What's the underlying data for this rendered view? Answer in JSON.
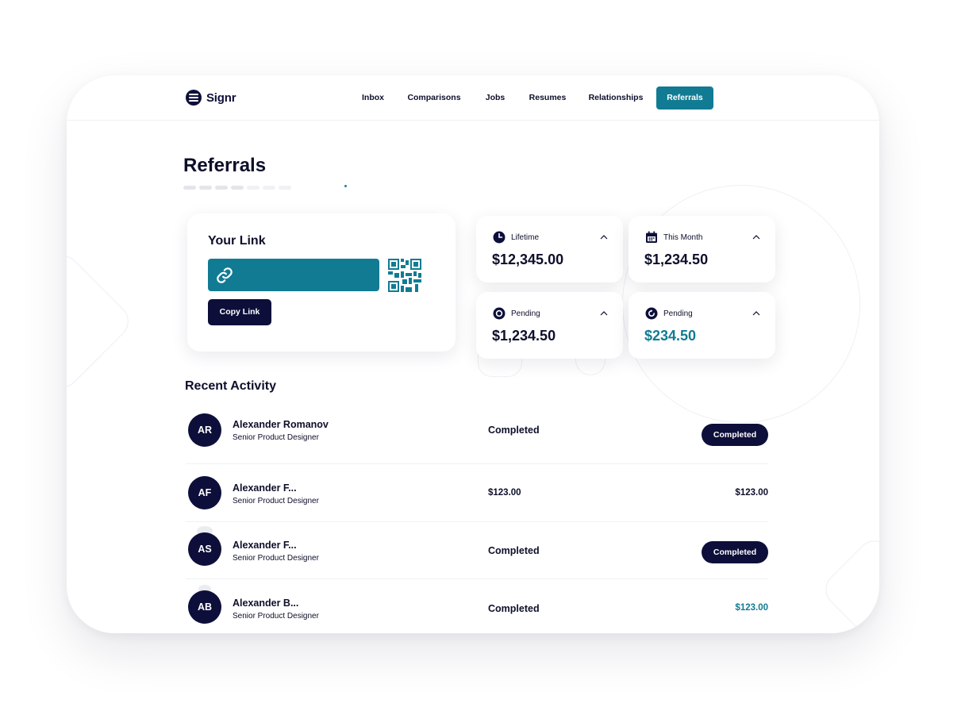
{
  "app": {
    "logo_text": "Signr"
  },
  "nav": {
    "items": [
      {
        "label": "Inbox"
      },
      {
        "label": "Comparisons"
      },
      {
        "label": "Jobs"
      },
      {
        "label": "Resumes"
      },
      {
        "label": "Relationships"
      },
      {
        "label": "Referrals",
        "active": true
      }
    ]
  },
  "page": {
    "title": "Referrals"
  },
  "link_card": {
    "heading": "Your Link",
    "copy_button": "Copy Link",
    "link_icon": "link-icon",
    "qr_icon": "qr-code-icon"
  },
  "stats": [
    {
      "icon": "clock-icon",
      "label": "Lifetime",
      "value": "$12,345.00",
      "accent": false
    },
    {
      "icon": "calendar-icon",
      "label": "This Month",
      "value": "$1,234.50",
      "accent": false
    },
    {
      "icon": "pending-icon",
      "label": "Pending",
      "value": "$1,234.50",
      "accent": false
    },
    {
      "icon": "refresh-icon",
      "label": "Pending",
      "value": "$234.50",
      "accent": true
    }
  ],
  "activity": {
    "title": "Recent Activity",
    "rows": [
      {
        "initials": "AR",
        "name": "Alexander Romanov",
        "role": "Senior Product Designer",
        "status": "Completed",
        "right_type": "pill",
        "right": "Completed"
      },
      {
        "initials": "AF",
        "name": "Alexander F...",
        "role": "Senior Product Designer",
        "status": "$123.00",
        "right_type": "amount",
        "right": "$123.00"
      },
      {
        "initials": "AS",
        "name": "Alexander F...",
        "role": "Senior Product Designer",
        "status": "Completed",
        "right_type": "pill",
        "right": "Completed"
      },
      {
        "initials": "AB",
        "name": "Alexander B...",
        "role": "Senior Product Designer",
        "status": "Completed",
        "right_type": "amount-accent",
        "right": "$123.00"
      }
    ]
  },
  "colors": {
    "brand": "#117b93",
    "navy": "#0d0f3a",
    "text": "#0d0f2a"
  }
}
